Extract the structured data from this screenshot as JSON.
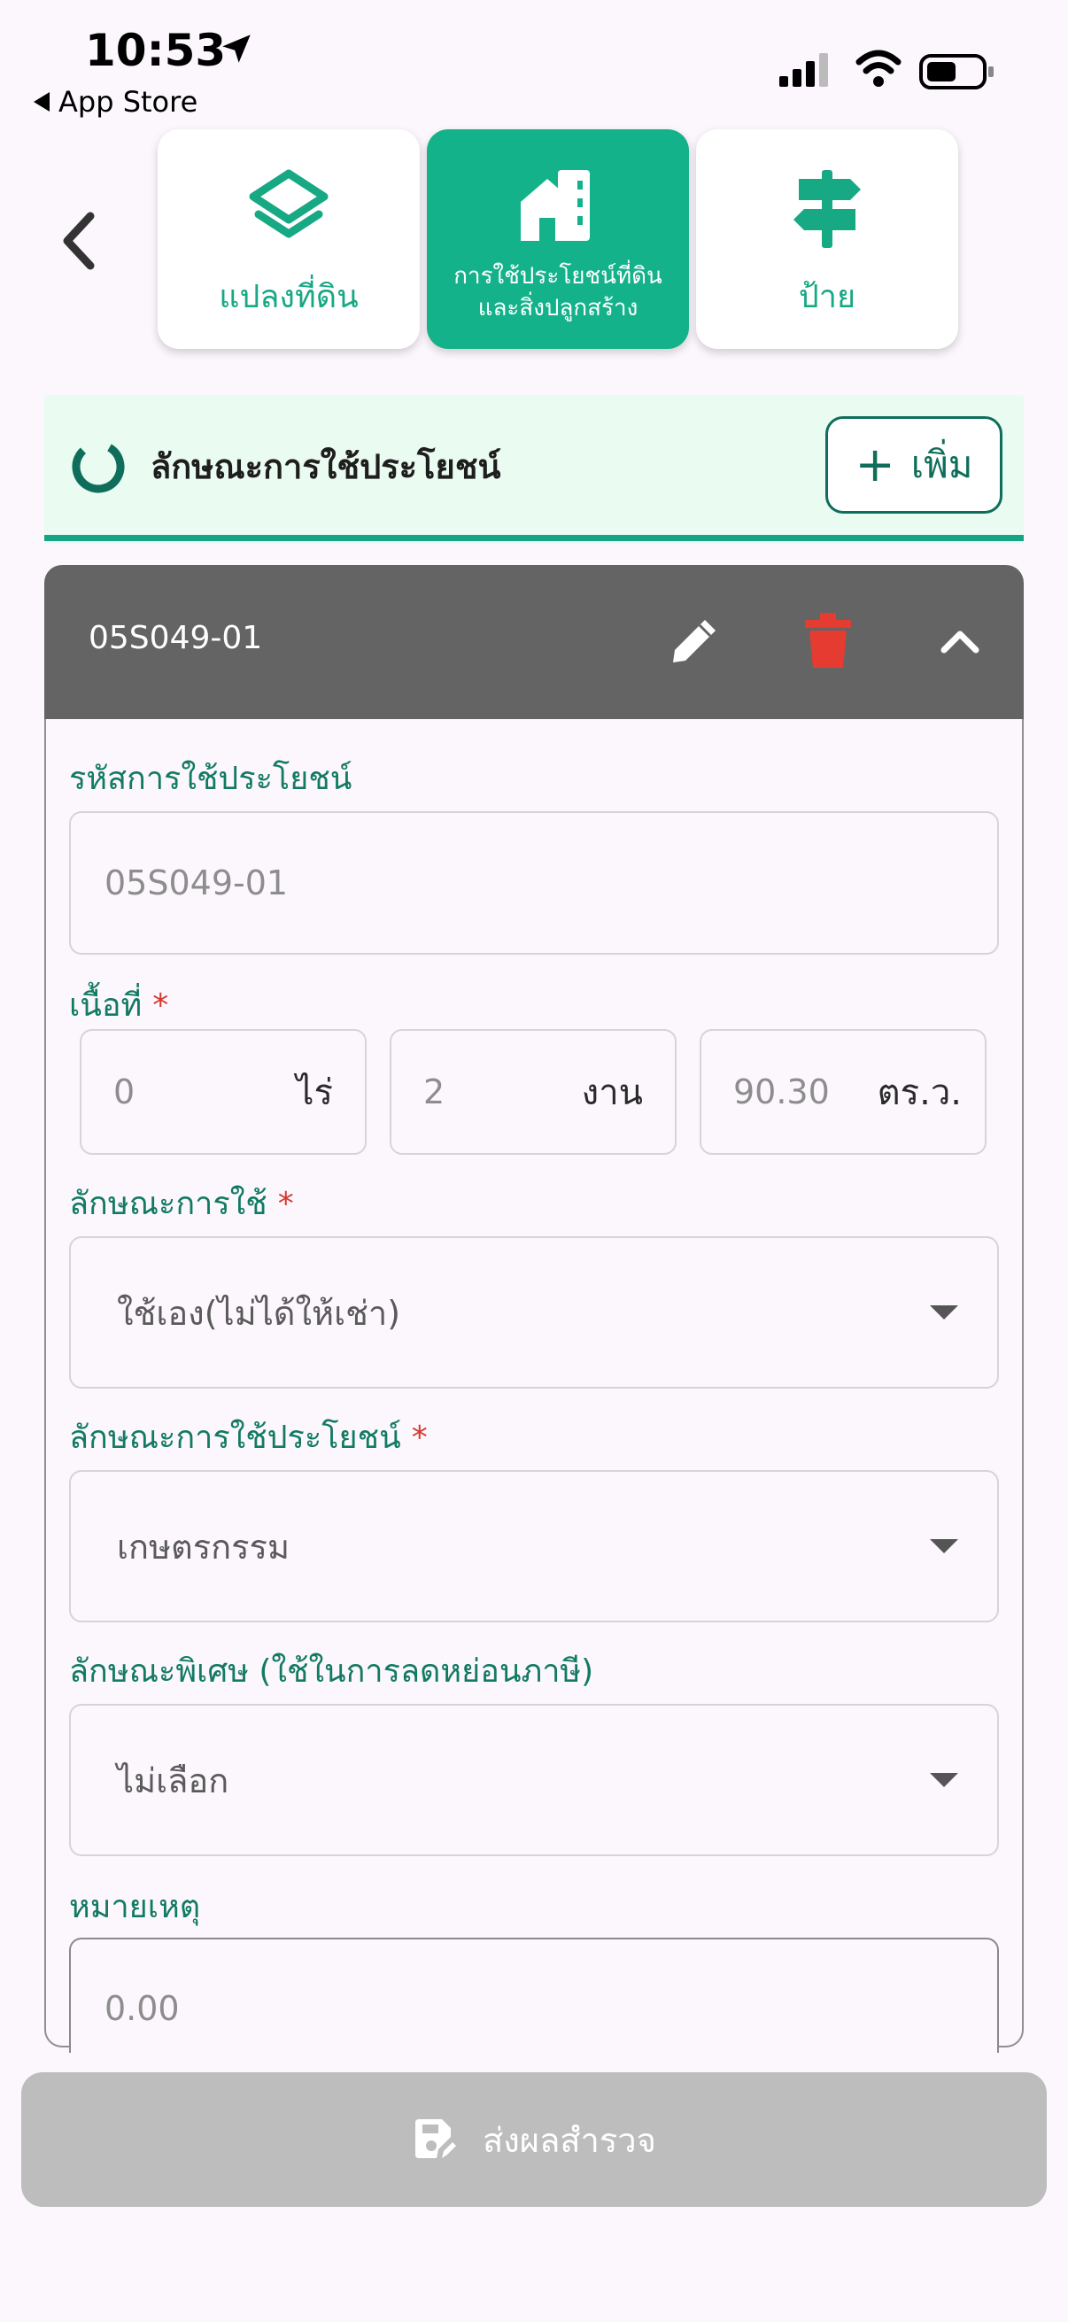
{
  "status_bar": {
    "time": "10:53",
    "back_app": "App Store"
  },
  "nav": {
    "tiles": [
      {
        "label": "แปลงที่ดิน",
        "icon": "layers-icon"
      },
      {
        "label_line1": "การใช้ประโยชน์ที่ดิน",
        "label_line2": "และสิ่งปลูกสร้าง",
        "icon": "building-icon",
        "active": true
      },
      {
        "label": "ป้าย",
        "icon": "signpost-icon"
      }
    ]
  },
  "section": {
    "title": "ลักษณะการใช้ประโยชน์",
    "add_label": "เพิ่ม",
    "add_symbol": "+"
  },
  "record": {
    "code": "05S049-01",
    "code_label": "รหัสการใช้ประโยชน์",
    "code_value": "05S049-01",
    "area_label": "เนื้อที่",
    "area": {
      "rai_value": "0",
      "rai_unit": "ไร่",
      "ngan_value": "2",
      "ngan_unit": "งาน",
      "wa_value": "90.30",
      "wa_unit": "ตร.ว."
    },
    "usage_type_label": "ลักษณะการใช้",
    "usage_type_value": "ใช้เอง(ไม่ได้ให้เช่า)",
    "usage_label": "ลักษณะการใช้ประโยชน์",
    "usage_value": "เกษตรกรรม",
    "special_label": "ลักษณะพิเศษ (ใช้ในการลดหย่อนภาษี)",
    "special_value": "ไม่เลือก",
    "note_label": "หมายเหตุ",
    "note_placeholder": "0.00",
    "required_mark": "*"
  },
  "submit_label": "ส่งผลสำรวจ",
  "colors": {
    "primary": "#14b28b",
    "header_gray": "#646464",
    "delete_red": "#e53b30",
    "label_green": "#127a63"
  }
}
